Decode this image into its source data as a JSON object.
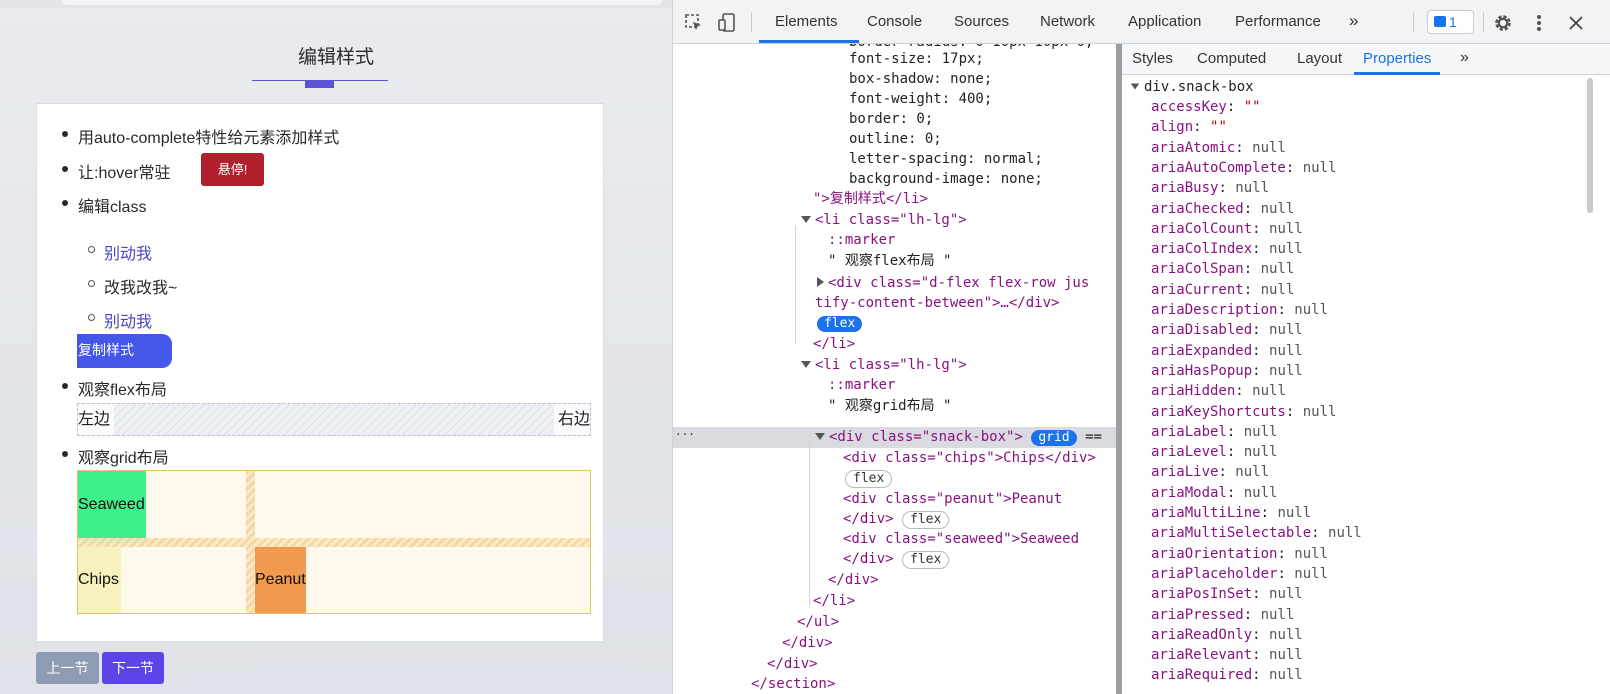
{
  "page": {
    "title": "编辑样式",
    "list": {
      "item1": "用auto-complete特性给元素添加样式",
      "item2": "让:hover常驻",
      "hover_badge": "悬停!",
      "item3": "编辑class",
      "sub1": "别动我",
      "sub2": "改我改我~",
      "sub3": "别动我",
      "copy_button": "复制样式",
      "item4": "观察flex布局",
      "flex_left": "左边",
      "flex_right": "右边",
      "item5": "观察grid布局",
      "grid": {
        "seaweed": "Seaweed",
        "chips": "Chips",
        "peanut": "Peanut"
      }
    },
    "nav": {
      "prev": "上一节",
      "next": "下一节"
    },
    "colors": {
      "accent": "#5b55d6",
      "badge": "#b1202d",
      "copy": "#4457e8",
      "seaweed": "#3ff08a",
      "chips": "#f7f2bd",
      "peanut": "#f1994f"
    }
  },
  "devtools": {
    "toolbar": {
      "tabs": [
        "Elements",
        "Console",
        "Sources",
        "Network",
        "Application",
        "Performance"
      ],
      "more": "»",
      "issues_count": "1"
    },
    "elements": {
      "styles_lines": [
        "font-size: 17px;",
        "box-shadow: none;",
        "font-weight: 400;",
        "border: 0;",
        "outline: 0;",
        "letter-spacing: normal;",
        "background-image: none;"
      ],
      "style_close": "\">复制样式</li>",
      "li_open": "<li class=\"lh-lg\">",
      "marker": "::marker",
      "text_flex": "\" 观察flex布局 \"",
      "div_flex_1": "<div class=\"d-flex flex-row jus",
      "div_flex_2": "tify-content-between\">…</div>",
      "flex_pill": "flex",
      "li_close": "</li>",
      "text_grid": "\" 观察grid布局 \"",
      "snack_box": "<div class=\"snack-box\">",
      "grid_pill": "grid",
      "chips_div": "<div class=\"chips\">Chips</div>",
      "peanut_div": "<div class=\"peanut\">Peanut",
      "seaweed_div": "<div class=\"seaweed\">Seaweed",
      "div_close": "</div>",
      "ul_close": "</ul>",
      "section_close": "</section>",
      "ellipsis": "···",
      "eq": "=="
    },
    "side": {
      "tabs": [
        "Styles",
        "Computed",
        "Layout",
        "Properties"
      ],
      "more": "»",
      "node": "div.snack-box",
      "props": [
        {
          "k": "accessKey",
          "v": "\"\""
        },
        {
          "k": "align",
          "v": "\"\""
        },
        {
          "k": "ariaAtomic",
          "v": "null"
        },
        {
          "k": "ariaAutoComplete",
          "v": "null"
        },
        {
          "k": "ariaBusy",
          "v": "null"
        },
        {
          "k": "ariaChecked",
          "v": "null"
        },
        {
          "k": "ariaColCount",
          "v": "null"
        },
        {
          "k": "ariaColIndex",
          "v": "null"
        },
        {
          "k": "ariaColSpan",
          "v": "null"
        },
        {
          "k": "ariaCurrent",
          "v": "null"
        },
        {
          "k": "ariaDescription",
          "v": "null"
        },
        {
          "k": "ariaDisabled",
          "v": "null"
        },
        {
          "k": "ariaExpanded",
          "v": "null"
        },
        {
          "k": "ariaHasPopup",
          "v": "null"
        },
        {
          "k": "ariaHidden",
          "v": "null"
        },
        {
          "k": "ariaKeyShortcuts",
          "v": "null"
        },
        {
          "k": "ariaLabel",
          "v": "null"
        },
        {
          "k": "ariaLevel",
          "v": "null"
        },
        {
          "k": "ariaLive",
          "v": "null"
        },
        {
          "k": "ariaModal",
          "v": "null"
        },
        {
          "k": "ariaMultiLine",
          "v": "null"
        },
        {
          "k": "ariaMultiSelectable",
          "v": "null"
        },
        {
          "k": "ariaOrientation",
          "v": "null"
        },
        {
          "k": "ariaPlaceholder",
          "v": "null"
        },
        {
          "k": "ariaPosInSet",
          "v": "null"
        },
        {
          "k": "ariaPressed",
          "v": "null"
        },
        {
          "k": "ariaReadOnly",
          "v": "null"
        },
        {
          "k": "ariaRelevant",
          "v": "null"
        },
        {
          "k": "ariaRequired",
          "v": "null"
        }
      ]
    }
  }
}
